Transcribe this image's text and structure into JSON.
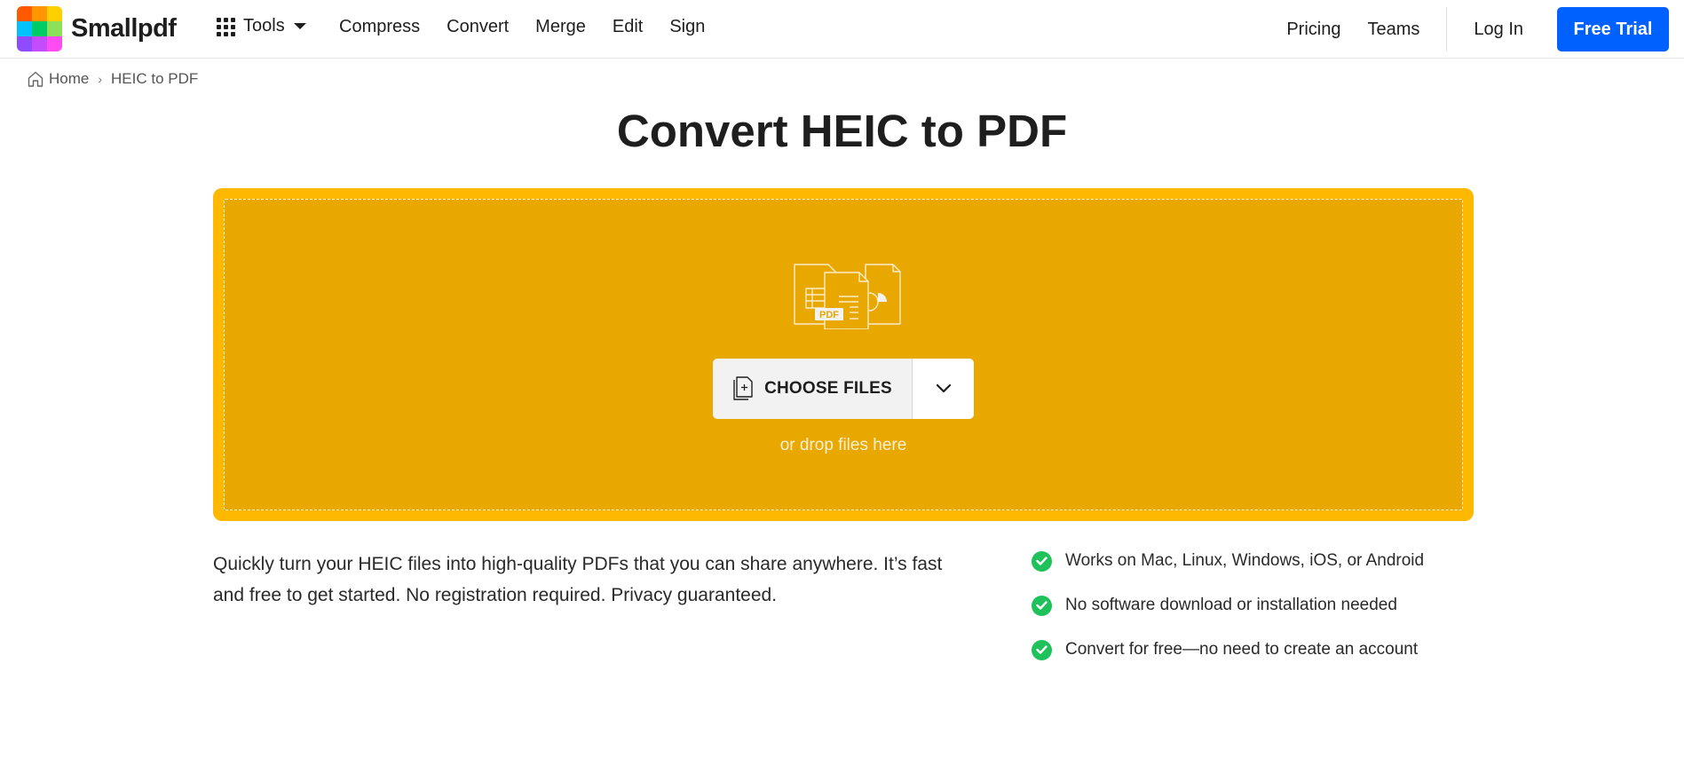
{
  "header": {
    "brand": "Smallpdf",
    "logo_colors": [
      "#ff5a00",
      "#ff9500",
      "#ffd000",
      "#00c2ff",
      "#00cc66",
      "#8de15a",
      "#8f4cff",
      "#c34cff",
      "#ff4cf0"
    ],
    "tools_label": "Tools",
    "nav": [
      "Compress",
      "Convert",
      "Merge",
      "Edit",
      "Sign"
    ],
    "right_links": [
      "Pricing",
      "Teams"
    ],
    "login_label": "Log In",
    "trial_label": "Free Trial",
    "accent": "#0061fe"
  },
  "breadcrumb": {
    "home": "Home",
    "separator": "›",
    "current": "HEIC to PDF"
  },
  "page_title": "Convert HEIC to PDF",
  "dropzone": {
    "illustration_badge": "PDF",
    "choose_label": "CHOOSE FILES",
    "drop_hint": "or drop files here",
    "outer_color": "#ffb800",
    "inner_color": "#e8a800"
  },
  "description": "Quickly turn your HEIC files into high-quality PDFs that you can share anywhere. It’s fast and free to get started. No registration required. Privacy guaranteed.",
  "features": [
    "Works on Mac, Linux, Windows, iOS, or Android",
    "No software download or installation needed",
    "Convert for free—no need to create an account"
  ]
}
